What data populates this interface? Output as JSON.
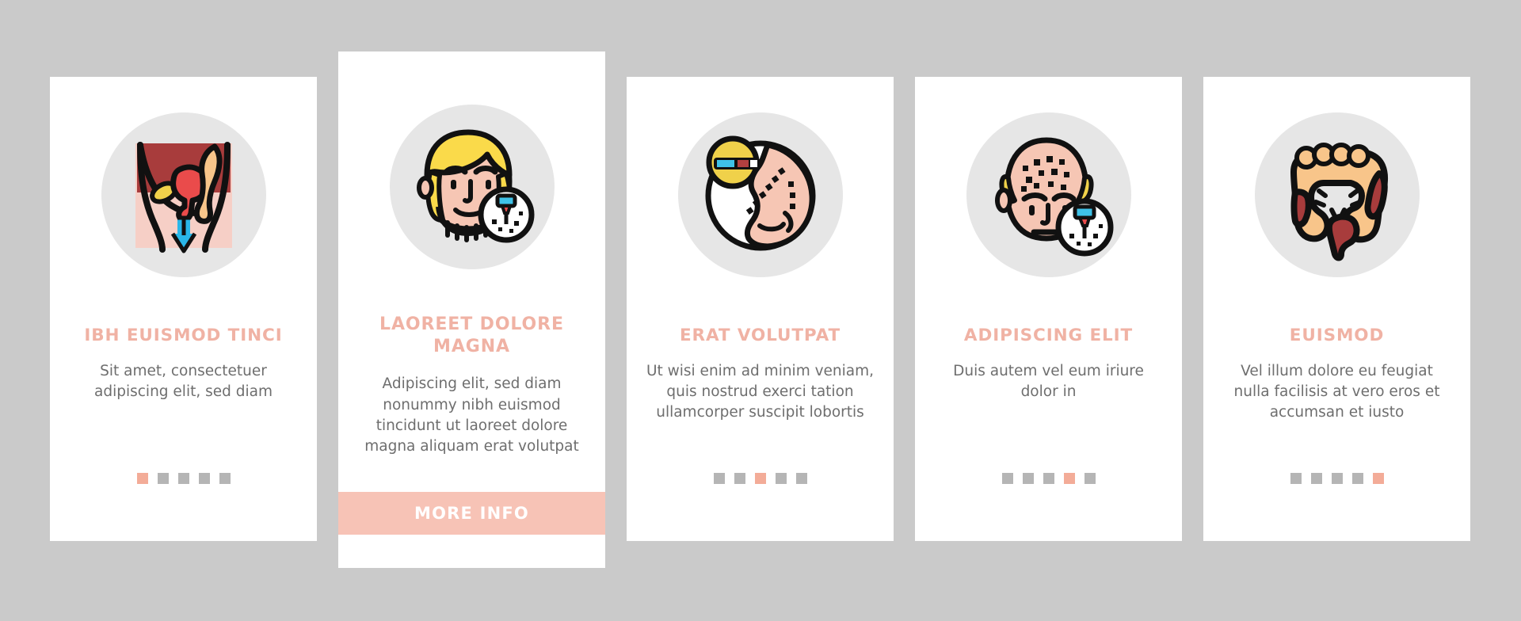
{
  "background_color": "#cacaca",
  "theme": {
    "card_background": "#ffffff",
    "title_color": "#f0b2a4",
    "body_color": "#6e6e6e",
    "accent_color": "#f3ac98",
    "button_background": "#f7c3b6",
    "button_text_color": "#ffffff",
    "icon_disc_color": "#e6e6e6",
    "dot_inactive_color": "#b5b5b5"
  },
  "cards": [
    {
      "id": "card-1",
      "featured": false,
      "icon_name": "pelvis-prolapse-icon",
      "title": "IBH EUISMOD TINCI",
      "body": "Sit amet, consectetuer adipiscing elit, sed diam",
      "dots": {
        "count": 5,
        "active_index": 0
      },
      "button": null
    },
    {
      "id": "card-2",
      "featured": true,
      "icon_name": "bearded-face-skin-test-icon",
      "title": "LAOREET DOLORE MAGNA",
      "body": "Adipiscing elit, sed diam nonummy nibh euismod tincidunt ut laoreet dolore magna aliquam erat volutpat",
      "dots": null,
      "button": {
        "label": "MORE INFO"
      }
    },
    {
      "id": "card-3",
      "featured": false,
      "icon_name": "nose-rhinoplasty-icon",
      "title": "ERAT VOLUTPAT",
      "body": "Ut wisi enim ad minim veniam, quis nostrud exerci tation ullamcorper suscipit lobortis",
      "dots": {
        "count": 5,
        "active_index": 2
      },
      "button": null
    },
    {
      "id": "card-4",
      "featured": false,
      "icon_name": "hair-transplant-head-icon",
      "title": "ADIPISCING ELIT",
      "body": "Duis autem vel eum iriure dolor in",
      "dots": {
        "count": 5,
        "active_index": 3
      },
      "button": null
    },
    {
      "id": "card-5",
      "featured": false,
      "icon_name": "colon-intestine-icon",
      "title": "EUISMOD",
      "body": "Vel illum dolore eu feugiat nulla facilisis at vero eros et accumsan et iusto",
      "dots": {
        "count": 5,
        "active_index": 4
      },
      "button": null
    }
  ]
}
